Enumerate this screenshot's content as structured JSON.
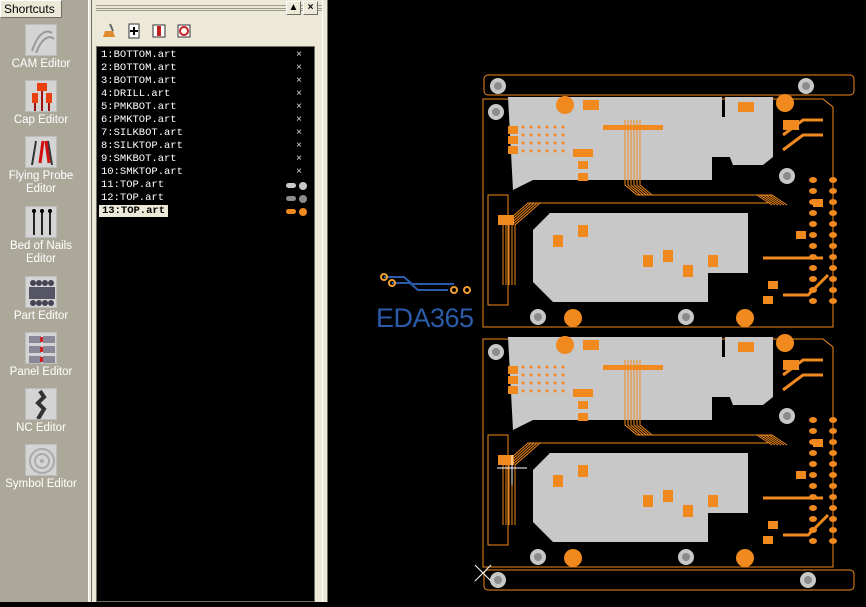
{
  "shortcuts": {
    "header": "Shortcuts",
    "items": [
      {
        "label": "CAM Editor",
        "icon": "cam-editor-icon"
      },
      {
        "label": "Cap Editor",
        "icon": "cap-editor-icon"
      },
      {
        "label": "Flying Probe Editor",
        "icon": "flying-probe-icon"
      },
      {
        "label": "Bed of Nails Editor",
        "icon": "bed-of-nails-icon"
      },
      {
        "label": "Part Editor",
        "icon": "part-editor-icon"
      },
      {
        "label": "Panel Editor",
        "icon": "panel-editor-icon"
      },
      {
        "label": "NC Editor",
        "icon": "nc-editor-icon"
      },
      {
        "label": "Symbol Editor",
        "icon": "symbol-editor-icon"
      }
    ]
  },
  "layers_panel": {
    "buttons": {
      "restore": "▲",
      "close": "×"
    },
    "toolbar": [
      "clear-icon",
      "add-layer-icon",
      "layer-off-icon",
      "layer-on-icon"
    ],
    "layers": [
      {
        "label": "1:BOTTOM.art",
        "state": "off"
      },
      {
        "label": "2:BOTTOM.art",
        "state": "off"
      },
      {
        "label": "3:BOTTOM.art",
        "state": "off"
      },
      {
        "label": "4:DRILL.art",
        "state": "off"
      },
      {
        "label": "5:PMKBOT.art",
        "state": "off"
      },
      {
        "label": "6:PMKTOP.art",
        "state": "off"
      },
      {
        "label": "7:SILKBOT.art",
        "state": "off"
      },
      {
        "label": "8:SILKTOP.art",
        "state": "off"
      },
      {
        "label": "9:SMKBOT.art",
        "state": "off"
      },
      {
        "label": "10:SMKTOP.art",
        "state": "off"
      },
      {
        "label": "11:TOP.art",
        "state": "on",
        "color": "#c8c8c8"
      },
      {
        "label": "12:TOP.art",
        "state": "on",
        "color": "#8c8c8c"
      },
      {
        "label": "13:TOP.art",
        "state": "on",
        "color": "#f08a1e",
        "selected": true
      }
    ],
    "off_mark": "×"
  },
  "canvas": {
    "watermark": "EDA365",
    "colors": {
      "copper": "#f08a1e",
      "pour": "#c8c8c8",
      "hole": "#8c8c8c",
      "watermark": "#2a5caa"
    }
  }
}
